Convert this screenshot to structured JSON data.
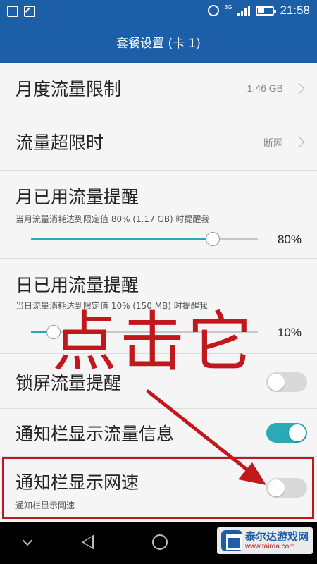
{
  "status_bar": {
    "network": "3G",
    "time": "21:58",
    "left_icons": [
      "screen-icon",
      "image-icon"
    ],
    "right_icons": [
      "alarm-icon",
      "signal-icon",
      "battery-icon"
    ]
  },
  "header": {
    "title": "套餐设置 (卡 1)"
  },
  "settings": {
    "monthly_limit": {
      "title": "月度流量限制",
      "value": "1.46 GB"
    },
    "over_limit": {
      "title": "流量超限时",
      "value": "断网"
    },
    "monthly_reminder": {
      "title": "月已用流量提醒",
      "subtitle": "当月流量消耗达到限定值 80% (1.17 GB) 时提醒我",
      "percent_label": "80%",
      "level": 0.8
    },
    "daily_reminder": {
      "title": "日已用流量提醒",
      "subtitle": "当日流量消耗达到限定值 10% (150 MB) 时提醒我",
      "percent_label": "10%",
      "level": 0.1
    },
    "lockscreen_reminder": {
      "title": "锁屏流量提醒",
      "enabled": false
    },
    "notification_traffic": {
      "title": "通知栏显示流量信息",
      "enabled": true
    },
    "notification_speed": {
      "title": "通知栏显示网速",
      "subtitle": "通知栏显示网速",
      "enabled": false
    }
  },
  "annotation": {
    "text": "点击它",
    "color": "#c0181c"
  },
  "nav_bar": {
    "icons": [
      "chevron-down-icon",
      "back-icon",
      "home-icon",
      "recent-apps-icon"
    ]
  },
  "watermark": {
    "title": "泰尔达游戏网",
    "url": "www.tairda.com"
  },
  "colors": {
    "primary": "#1c5fa8",
    "accent": "#2aa9b6",
    "annotation": "#c0181c",
    "background": "#f5f5f5"
  }
}
